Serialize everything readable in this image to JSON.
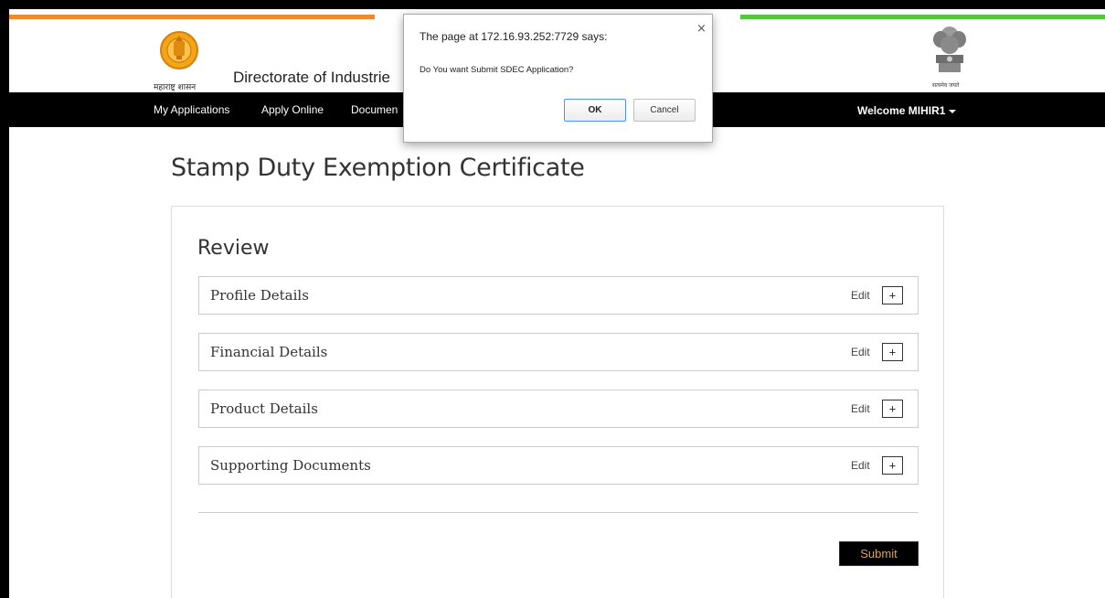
{
  "header": {
    "marathi_caption": "महाराष्ट्र शासन",
    "department_title": "Directorate of Industrie",
    "emblem_caption": "सत्यमेव जयते"
  },
  "nav": {
    "items": [
      {
        "label": "My Applications"
      },
      {
        "label": "Apply Online"
      },
      {
        "label": "Documen"
      }
    ],
    "welcome": "Welcome MIHIR1"
  },
  "page": {
    "title": "Stamp Duty Exemption Certificate"
  },
  "review": {
    "heading": "Review",
    "edit_label": "Edit",
    "expand_symbol": "+",
    "sections": [
      {
        "label": "Profile Details"
      },
      {
        "label": "Financial Details"
      },
      {
        "label": "Product Details"
      },
      {
        "label": "Supporting Documents"
      }
    ],
    "submit_label": "Submit"
  },
  "dialog": {
    "title": "The page at 172.16.93.252:7729 says:",
    "message": "Do You want Submit SDEC Application?",
    "ok_label": "OK",
    "cancel_label": "Cancel",
    "close_symbol": "×"
  },
  "colors": {
    "saffron": "#ef8a2c",
    "green": "#55c540",
    "nav_bg": "#000000",
    "submit_text": "#e8a23a",
    "emblem_gold": "#f2a516"
  }
}
